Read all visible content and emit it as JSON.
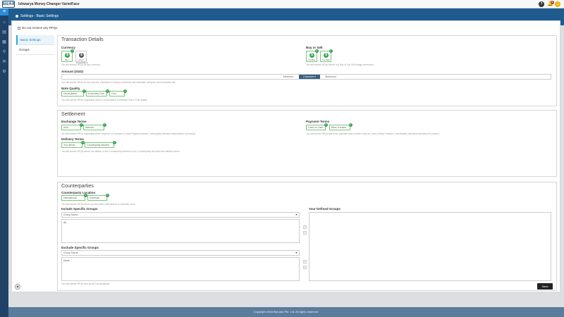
{
  "topbar": {
    "logo": "bizAX",
    "title": "Ishwarya Money Changer VarietFace",
    "help": "?",
    "bell": "🔔",
    "notification_count": "5",
    "avatar": "☺"
  },
  "nav": {
    "toggle": "≡",
    "icons": [
      "⌂",
      "▤",
      "▦",
      "⚲",
      "✉",
      "⚙"
    ]
  },
  "header": {
    "title": "Settings - Basic Settings"
  },
  "settings": {
    "do_not_receive_label": "Do not receive any RFQs",
    "tabs": [
      {
        "label": "Basic Settings",
        "active": true
      },
      {
        "label": "Groups",
        "active": false
      }
    ]
  },
  "transaction": {
    "title": "Transaction Details",
    "currency_label": "Currency",
    "currencies": [
      {
        "label": "Buy",
        "selected": true
      },
      {
        "label": "From Commission",
        "selected": false
      }
    ],
    "currency_hint": "You will receive RFQs for any currency.",
    "buy_sell_label": "Buy or Sell",
    "buy_sell": [
      {
        "label": "You Buy",
        "selected": true
      },
      {
        "label": "You Sell",
        "selected": true
      }
    ],
    "buy_sell_hint": "You will receive RFQs where You Buy or You Sell foreign currencies.",
    "amount_label": "Amount (SGD)",
    "amount_options": [
      "Minimum",
      "2 Amount ▾",
      "Maximum"
    ],
    "amount_hint": "You will receive RFQs for any amount, equivalent in foreign currencies and estimated using the current market rate.",
    "note_quality_label": "Note Quality",
    "note_quality_options": [
      "Uncirculated",
      "Extremely Fine",
      "Fine"
    ],
    "note_quality_hint": "You will receive RFQs requesting notes in Uncirculated, Extremely Fine or Fine quality."
  },
  "settlement": {
    "title": "Settlement",
    "exchange_terms_label": "Exchange Terms",
    "exchange_terms": [
      "Auto",
      "Netchat"
    ],
    "exchange_terms_hint": "You will receive RFQs requesting either Payment on Payment or Upon Payment before Counterparty will send notes/dollars for product.",
    "payment_terms_label": "Payment Terms",
    "payment_terms": [
      "Cash on Cash",
      "Bank Transfer"
    ],
    "payment_terms_hint": "You will receive RFQs where the payment term is either Cash on Cash or Bank Transfer. Counterparty will select whichever fit product.",
    "delivery_terms_label": "Delivery Terms",
    "delivery_terms": [
      "You deliver",
      "Counterparty delivers"
    ],
    "delivery_terms_hint": "You will receive RFQs where You deliver or the Counterparty delivers to you. Counterparty will select the delivery terms."
  },
  "counterparties": {
    "title": "Counterparties",
    "location_label": "Counterparty Location",
    "locations": [
      "International",
      "Domestic"
    ],
    "location_hint": "You will receive RFQs where you are there International or Domestic ones.",
    "include_label": "Include Specific Groups",
    "include_placeholder": "Group Name",
    "include_value": "All",
    "exclude_label": "Exclude Specific Groups",
    "exclude_placeholder": "Group Name",
    "exclude_value": "None",
    "your_groups_label": "Your Defined Groups",
    "groups_hint": "You will receive RFQs sent by All Counterparties."
  },
  "actions": {
    "save": "Save",
    "back": "◉"
  },
  "footer": {
    "copyright": "Copyright 2018 BizLabs Pte. Ltd. All rights reserved."
  }
}
